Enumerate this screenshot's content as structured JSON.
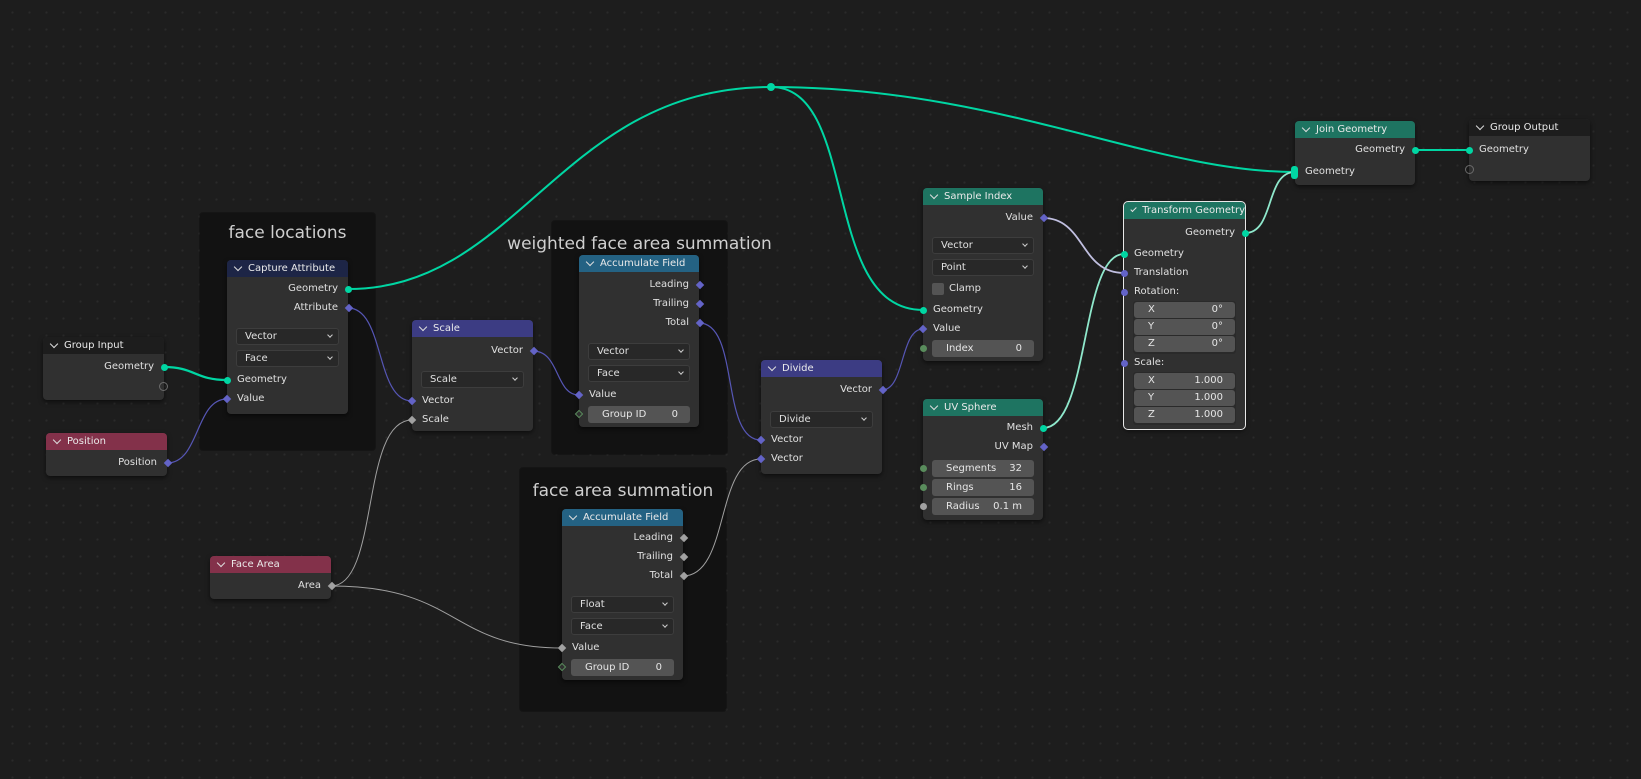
{
  "editor": "Geometry Node Editor",
  "colors": {
    "geometry_socket": "#00d6a3",
    "vector_socket": "#6363c7",
    "float_socket": "#a1a1a1",
    "integer_socket": "#598c5c",
    "header_input": "#83314a",
    "header_attribute": "#1d2546",
    "header_converter": "#246283",
    "header_vector": "#3c3c83",
    "header_geometry": "#1e7461",
    "header_group": "#1d1d1d",
    "canvas_bg": "#1d1d1d",
    "frame_bg": "#121212"
  },
  "frames": {
    "face_locations": "face locations",
    "weighted_sum": "weighted face area summation",
    "area_sum": "face area summation"
  },
  "nodes": {
    "group_input": {
      "title": "Group Input",
      "outputs": [
        "Geometry"
      ]
    },
    "position": {
      "title": "Position",
      "outputs": [
        "Position"
      ]
    },
    "capture_attribute": {
      "title": "Capture Attribute",
      "outputs": [
        "Geometry",
        "Attribute"
      ],
      "data_type": "Vector",
      "domain": "Face",
      "inputs": [
        "Geometry",
        "Value"
      ]
    },
    "scale": {
      "title": "Scale",
      "outputs": [
        "Vector"
      ],
      "operation": "Scale",
      "inputs": [
        "Vector",
        "Scale"
      ]
    },
    "accumulate_weighted": {
      "title": "Accumulate Field",
      "outputs": [
        "Leading",
        "Trailing",
        "Total"
      ],
      "data_type": "Vector",
      "domain": "Face",
      "inputs": [
        "Value"
      ],
      "group_id_label": "Group ID",
      "group_id_value": "0"
    },
    "face_area": {
      "title": "Face Area",
      "outputs": [
        "Area"
      ]
    },
    "accumulate_area": {
      "title": "Accumulate Field",
      "outputs": [
        "Leading",
        "Trailing",
        "Total"
      ],
      "data_type": "Float",
      "domain": "Face",
      "inputs": [
        "Value"
      ],
      "group_id_label": "Group ID",
      "group_id_value": "0"
    },
    "divide": {
      "title": "Divide",
      "outputs": [
        "Vector"
      ],
      "operation": "Divide",
      "inputs": [
        "Vector",
        "Vector"
      ]
    },
    "sample_index": {
      "title": "Sample Index",
      "outputs": [
        "Value"
      ],
      "data_type": "Vector",
      "domain": "Point",
      "clamp_label": "Clamp",
      "clamp_checked": false,
      "inputs": [
        "Geometry",
        "Value"
      ],
      "index_label": "Index",
      "index_value": "0"
    },
    "uv_sphere": {
      "title": "UV Sphere",
      "outputs": [
        "Mesh",
        "UV Map"
      ],
      "fields": [
        {
          "label": "Segments",
          "value": "32"
        },
        {
          "label": "Rings",
          "value": "16"
        },
        {
          "label": "Radius",
          "value": "0.1 m"
        }
      ]
    },
    "transform_geometry": {
      "title": "Transform Geometry",
      "outputs": [
        "Geometry"
      ],
      "inputs": [
        "Geometry",
        "Translation"
      ],
      "rotation_label": "Rotation:",
      "rotation": [
        {
          "axis": "X",
          "value": "0°"
        },
        {
          "axis": "Y",
          "value": "0°"
        },
        {
          "axis": "Z",
          "value": "0°"
        }
      ],
      "scale_label": "Scale:",
      "scale": [
        {
          "axis": "X",
          "value": "1.000"
        },
        {
          "axis": "Y",
          "value": "1.000"
        },
        {
          "axis": "Z",
          "value": "1.000"
        }
      ]
    },
    "join_geometry": {
      "title": "Join Geometry",
      "outputs": [
        "Geometry"
      ],
      "inputs": [
        "Geometry"
      ]
    },
    "group_output": {
      "title": "Group Output",
      "inputs": [
        "Geometry"
      ]
    }
  }
}
